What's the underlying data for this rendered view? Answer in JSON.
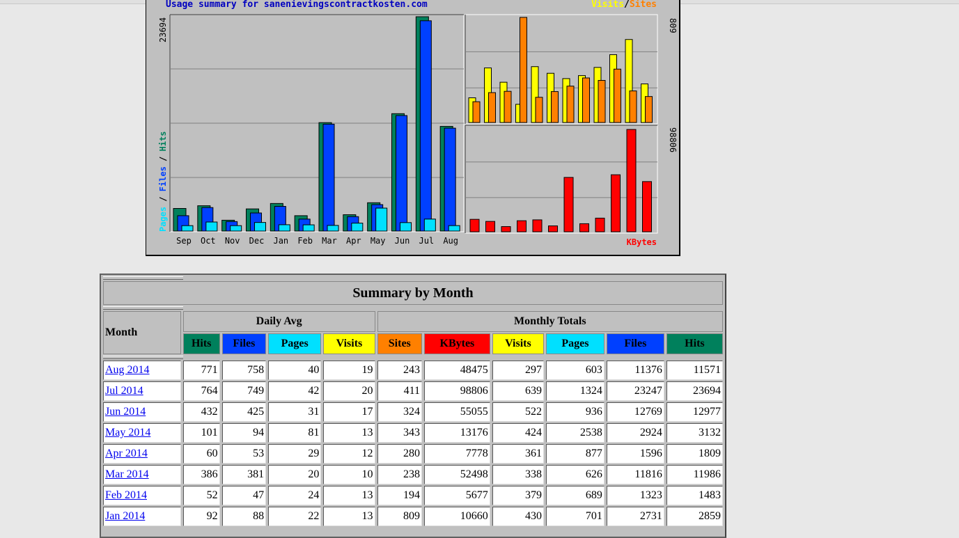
{
  "chart_data": {
    "type": "bar",
    "title": "Usage summary for sanenievingscontractkosten.com",
    "categories": [
      "Sep",
      "Oct",
      "Nov",
      "Dec",
      "Jan",
      "Feb",
      "Mar",
      "Apr",
      "May",
      "Jun",
      "Jul",
      "Aug"
    ],
    "main": {
      "ymax_label": "23694",
      "ymax": 23694,
      "legend_pages": "Pages",
      "legend_files": "Files",
      "legend_hits": "Hits",
      "legend_sep": "/",
      "series": [
        {
          "name": "Hits",
          "color": "#00805c",
          "values": [
            2500,
            2800,
            1200,
            2450,
            3050,
            1700,
            11986,
            1809,
            3132,
            12977,
            23694,
            11571
          ]
        },
        {
          "name": "Files",
          "color": "#0040ff",
          "values": [
            1700,
            2600,
            1050,
            2000,
            2731,
            1323,
            11816,
            1596,
            2924,
            12769,
            23247,
            11376
          ]
        },
        {
          "name": "Pages",
          "color": "#00e0ff",
          "values": [
            600,
            1000,
            600,
            950,
            701,
            689,
            626,
            877,
            2538,
            936,
            1324,
            603
          ]
        }
      ]
    },
    "visits_sites": {
      "ymax_label": "809",
      "ymax": 809,
      "legend_visits": "Visits",
      "legend_sites": "Sites",
      "legend_sep": "/",
      "series": [
        {
          "name": "Visits",
          "color": "#ffff00",
          "values": [
            190,
            420,
            310,
            140,
            430,
            379,
            338,
            361,
            424,
            522,
            639,
            297
          ]
        },
        {
          "name": "Sites",
          "color": "#ff8000",
          "values": [
            160,
            230,
            240,
            809,
            194,
            238,
            280,
            343,
            324,
            411,
            243,
            200
          ]
        }
      ]
    },
    "kbytes": {
      "ymax_label": "98806",
      "ymax": 98806,
      "legend_kbytes": "KBytes",
      "series": [
        {
          "name": "KBytes",
          "color": "#ff0000",
          "values": [
            12000,
            10000,
            5000,
            10660,
            11500,
            5677,
            52498,
            7778,
            13176,
            55055,
            98806,
            48475
          ]
        }
      ]
    }
  },
  "table": {
    "title": "Summary by Month",
    "month_header": "Month",
    "group_daily": "Daily Avg",
    "group_monthly": "Monthly Totals",
    "daily_cols": [
      "Hits",
      "Files",
      "Pages",
      "Visits"
    ],
    "monthly_cols": [
      "Sites",
      "KBytes",
      "Visits",
      "Pages",
      "Files",
      "Hits"
    ],
    "rows": [
      {
        "month": "Aug 2014",
        "vals": [
          "771",
          "758",
          "40",
          "19",
          "243",
          "48475",
          "297",
          "603",
          "11376",
          "11571"
        ]
      },
      {
        "month": "Jul 2014",
        "vals": [
          "764",
          "749",
          "42",
          "20",
          "411",
          "98806",
          "639",
          "1324",
          "23247",
          "23694"
        ]
      },
      {
        "month": "Jun 2014",
        "vals": [
          "432",
          "425",
          "31",
          "17",
          "324",
          "55055",
          "522",
          "936",
          "12769",
          "12977"
        ]
      },
      {
        "month": "May 2014",
        "vals": [
          "101",
          "94",
          "81",
          "13",
          "343",
          "13176",
          "424",
          "2538",
          "2924",
          "3132"
        ]
      },
      {
        "month": "Apr 2014",
        "vals": [
          "60",
          "53",
          "29",
          "12",
          "280",
          "7778",
          "361",
          "877",
          "1596",
          "1809"
        ]
      },
      {
        "month": "Mar 2014",
        "vals": [
          "386",
          "381",
          "20",
          "10",
          "238",
          "52498",
          "338",
          "626",
          "11816",
          "11986"
        ]
      },
      {
        "month": "Feb 2014",
        "vals": [
          "52",
          "47",
          "24",
          "13",
          "194",
          "5677",
          "379",
          "689",
          "1323",
          "1483"
        ]
      },
      {
        "month": "Jan 2014",
        "vals": [
          "92",
          "88",
          "22",
          "13",
          "809",
          "10660",
          "430",
          "701",
          "2731",
          "2859"
        ]
      }
    ]
  }
}
